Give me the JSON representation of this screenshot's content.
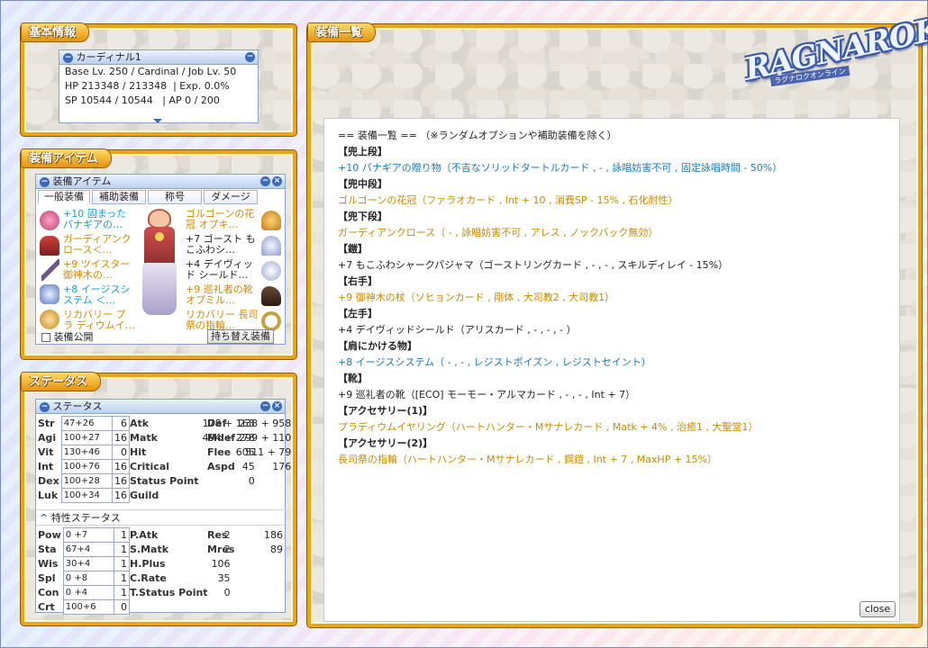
{
  "colors": {
    "panel_border": "#e7a51a",
    "blue_text": "#1a7ab8",
    "orange_text": "#c98a00"
  },
  "basic": {
    "title": "基本情報",
    "char_name": "カーディナル1",
    "line1": "Base Lv. 250 / Cardinal / Job Lv. 50",
    "line2a": "HP 213348 / 213348",
    "line2b": "| Exp. 0.0%",
    "line3a": "SP 10544 / 10544",
    "line3b": "| AP 0 / 200"
  },
  "equip_item": {
    "title": "装備アイテム",
    "window_title": "装備アイテム",
    "tabs": [
      "一般装備",
      "補助装備",
      "称号",
      "ダメージ"
    ],
    "left": [
      {
        "text": "+10 固まった パナギアの…",
        "icon": "headgear-icon",
        "color": "blue"
      },
      {
        "text": "ガーディアンク ロース＜…",
        "icon": "mid-headgear-icon",
        "color": "orange"
      },
      {
        "text": "+9 ツイスター 御神木の…",
        "icon": "staff-icon",
        "color": "orange"
      },
      {
        "text": "+8 イージスシ ステム ＜…",
        "icon": "garment-icon",
        "color": "blue"
      },
      {
        "text": "リカバリー プラ ディウムイ…",
        "icon": "accessory-icon",
        "color": "orange"
      }
    ],
    "right": [
      {
        "text": "ゴルゴーンの花 冠 オプキ…",
        "icon": "wings-icon",
        "color": "orange"
      },
      {
        "text": "+7 ゴースト も こふわシ…",
        "icon": "ghost-armor-icon",
        "color": "black"
      },
      {
        "text": "+4 デイヴィッド シールド…",
        "icon": "shield-icon",
        "color": "black"
      },
      {
        "text": "+9 巡礼者の靴 オプミル…",
        "icon": "shoes-icon",
        "color": "orange"
      },
      {
        "text": "リカバリー 長司 祭の指輪…",
        "icon": "ring-icon",
        "color": "orange"
      }
    ],
    "public_label": "装備公開",
    "switch_label": "持ち替え装備"
  },
  "status": {
    "title": "ステータス",
    "window_title": "ステータス",
    "stats": [
      {
        "name": "Str",
        "val": "47+26",
        "pt": "6"
      },
      {
        "name": "Agi",
        "val": "100+27",
        "pt": "16"
      },
      {
        "name": "Vit",
        "val": "130+46",
        "pt": "0"
      },
      {
        "name": "Int",
        "val": "100+76",
        "pt": "16"
      },
      {
        "name": "Dex",
        "val": "100+28",
        "pt": "16"
      },
      {
        "name": "Luk",
        "val": "100+34",
        "pt": "16"
      }
    ],
    "mid": [
      {
        "name": "Atk",
        "val": "178 + 163"
      },
      {
        "name": "Matk",
        "val": "494 + 278"
      },
      {
        "name": "Hit",
        "val": "605"
      },
      {
        "name": "Critical",
        "val": "45"
      },
      {
        "name": "Status Point",
        "val": "0"
      },
      {
        "name": "Guild",
        "val": ""
      }
    ],
    "right": [
      {
        "name": "Def",
        "val": "238 + 958"
      },
      {
        "name": "Mdef",
        "val": "299 + 110"
      },
      {
        "name": "Flee",
        "val": "511 + 79"
      },
      {
        "name": "Aspd",
        "val": "176"
      }
    ],
    "trait_title": "特性ステータス",
    "traits": [
      {
        "name": "Pow",
        "val": "0 +7",
        "pt": "1"
      },
      {
        "name": "Sta",
        "val": "67+4",
        "pt": "1"
      },
      {
        "name": "Wis",
        "val": "30+4",
        "pt": "1"
      },
      {
        "name": "Spl",
        "val": "0 +8",
        "pt": "1"
      },
      {
        "name": "Con",
        "val": "0 +4",
        "pt": "1"
      },
      {
        "name": "Crt",
        "val": "100+6",
        "pt": "0"
      }
    ],
    "tmid": [
      {
        "name": "P.Atk",
        "val": "2"
      },
      {
        "name": "S.Matk",
        "val": "2"
      },
      {
        "name": "H.Plus",
        "val": "106"
      },
      {
        "name": "C.Rate",
        "val": "35"
      },
      {
        "name": "T.Status Point",
        "val": "0"
      }
    ],
    "tright": [
      {
        "name": "Res",
        "val": "186"
      },
      {
        "name": "Mres",
        "val": "89"
      }
    ]
  },
  "list": {
    "title": "装備一覧",
    "logo_text": "RAGNAROK",
    "logo_sub": "ラグナロクオンライン",
    "lines": [
      {
        "t": "== 装備一覧 == （※ランダムオプションや補助装備を除く）",
        "c": "k"
      },
      {
        "t": "【兜上段】",
        "c": "h"
      },
      {
        "t": "+10 パナギアの贈り物（不吉なソリッドタートルカード , - , 詠唱妨害不可 , 固定詠唱時間 - 50%）",
        "c": "b"
      },
      {
        "t": "【兜中段】",
        "c": "h"
      },
      {
        "t": "ゴルゴーンの花冠（ファラオカード , Int + 10 , 消費SP - 15% , 石化耐性）",
        "c": "o"
      },
      {
        "t": "【兜下段】",
        "c": "h"
      },
      {
        "t": "ガーディアンクロース（ - , 詠唱妨害不可 , アレス , ノックバック無効）",
        "c": "o"
      },
      {
        "t": "【鎧】",
        "c": "h"
      },
      {
        "t": "+7 もこふわシャークパジャマ（ゴーストリングカード , - , - , スキルディレイ - 15%）",
        "c": "k"
      },
      {
        "t": "【右手】",
        "c": "h"
      },
      {
        "t": "+9 御神木の杖（ソヒョンカード , 剛体 , 大司教2 , 大司教1）",
        "c": "o"
      },
      {
        "t": "【左手】",
        "c": "h"
      },
      {
        "t": "+4 デイヴィッドシールド（アリスカード , - , - , - ）",
        "c": "k"
      },
      {
        "t": "【肩にかける物】",
        "c": "h"
      },
      {
        "t": "+8 イージスシステム（ - , - , レジストポイズン , レジストセイント）",
        "c": "b"
      },
      {
        "t": "【靴】",
        "c": "h"
      },
      {
        "t": "+9 巡礼者の靴（[ECO] モーモー・アルマカード , - , - , Int + 7）",
        "c": "k"
      },
      {
        "t": "【アクセサリー(1)】",
        "c": "h"
      },
      {
        "t": "プラディウムイヤリング（ハートハンター・Mサナレカード , Matk + 4% , 治癒1 , 大聖堂1）",
        "c": "o"
      },
      {
        "t": "【アクセサリー(2)】",
        "c": "h"
      },
      {
        "t": "長司祭の指輪（ハートハンター・Mサナレカード , 鋼鎧 , Int + 7 , MaxHP + 15%）",
        "c": "o"
      }
    ],
    "close_label": "close"
  }
}
